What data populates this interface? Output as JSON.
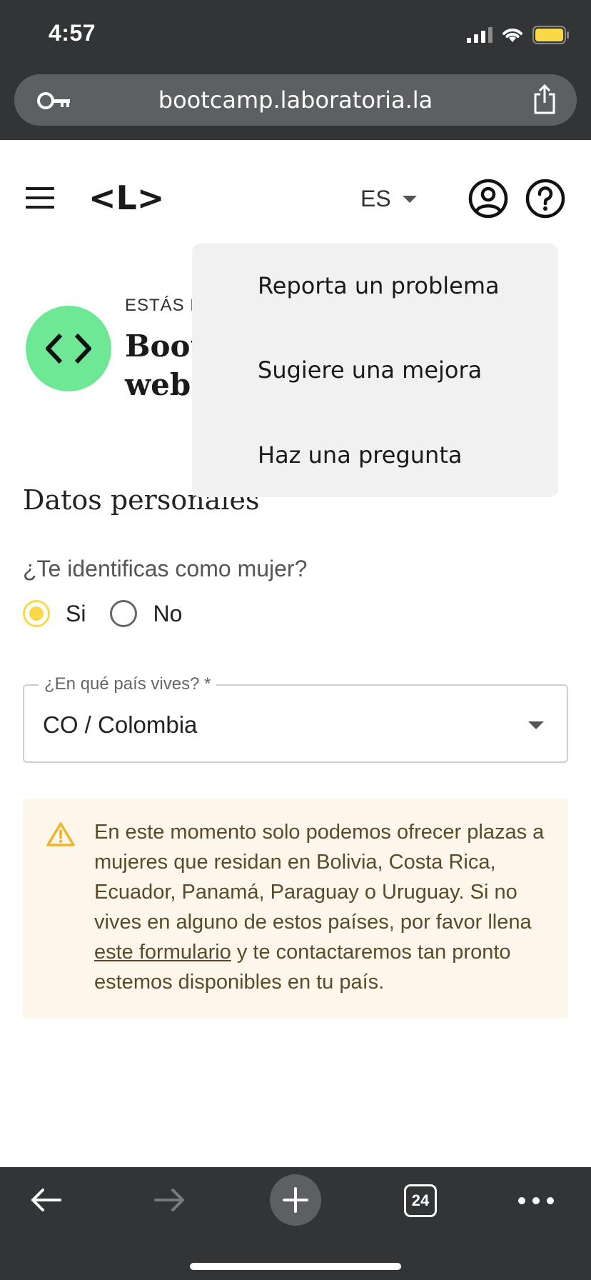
{
  "status_bar": {
    "time": "4:57"
  },
  "browser": {
    "url": "bootcamp.laboratoria.la",
    "tab_count": "24"
  },
  "header": {
    "logo": "<L>",
    "language": "ES"
  },
  "help_menu": {
    "items": [
      "Reporta un problema",
      "Sugiere una mejora",
      "Haz una pregunta"
    ]
  },
  "course": {
    "eyebrow": "ESTÁS P",
    "title": "Boot\nweb"
  },
  "form": {
    "section_title": "Datos personales",
    "question": "¿Te identificas como mujer?",
    "options": [
      {
        "label": "Si",
        "selected": true
      },
      {
        "label": "No",
        "selected": false
      }
    ],
    "country_label": "¿En qué país vives? *",
    "country_value": "CO / Colombia"
  },
  "warning": {
    "text_before": "En este momento solo podemos ofrecer plazas a mujeres que residan en Bolivia, Costa Rica, Ecuador, Panamá, Paraguay o Uruguay. Si no vives en alguno de estos países, por favor llena ",
    "link_text": "este formulario",
    "text_after": " y te contactaremos tan pronto estemos disponibles en tu país."
  },
  "colors": {
    "browser_chrome": "#333436",
    "accent_yellow": "#f9d84a",
    "course_badge": "#6ee895",
    "warning_bg": "#fdf6ea",
    "warning_icon": "#f0b429"
  }
}
